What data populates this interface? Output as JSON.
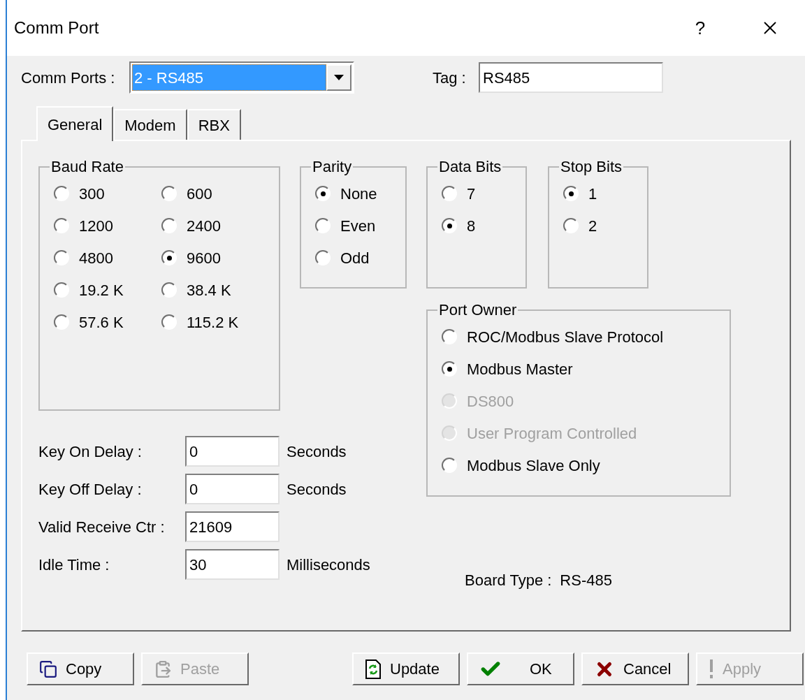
{
  "window": {
    "title": "Comm Port",
    "help": "?"
  },
  "comm_ports": {
    "label": "Comm Ports :",
    "value": "2 - RS485"
  },
  "tag": {
    "label": "Tag :",
    "value": "RS485"
  },
  "tabs": [
    {
      "label": "General",
      "selected": true
    },
    {
      "label": "Modem",
      "selected": false
    },
    {
      "label": "RBX",
      "selected": false
    }
  ],
  "baud_rate": {
    "title": "Baud Rate",
    "options": [
      {
        "label": "300",
        "selected": false
      },
      {
        "label": "600",
        "selected": false
      },
      {
        "label": "1200",
        "selected": false
      },
      {
        "label": "2400",
        "selected": false
      },
      {
        "label": "4800",
        "selected": false
      },
      {
        "label": "9600",
        "selected": true
      },
      {
        "label": "19.2 K",
        "selected": false
      },
      {
        "label": "38.4 K",
        "selected": false
      },
      {
        "label": "57.6 K",
        "selected": false
      },
      {
        "label": "115.2 K",
        "selected": false
      }
    ]
  },
  "parity": {
    "title": "Parity",
    "options": [
      {
        "label": "None",
        "selected": true
      },
      {
        "label": "Even",
        "selected": false
      },
      {
        "label": "Odd",
        "selected": false
      }
    ]
  },
  "data_bits": {
    "title": "Data Bits",
    "options": [
      {
        "label": "7",
        "selected": false
      },
      {
        "label": "8",
        "selected": true
      }
    ]
  },
  "stop_bits": {
    "title": "Stop Bits",
    "options": [
      {
        "label": "1",
        "selected": true
      },
      {
        "label": "2",
        "selected": false
      }
    ]
  },
  "port_owner": {
    "title": "Port Owner",
    "options": [
      {
        "label": "ROC/Modbus Slave Protocol",
        "selected": false,
        "disabled": false
      },
      {
        "label": "Modbus Master",
        "selected": true,
        "disabled": false
      },
      {
        "label": "DS800",
        "selected": false,
        "disabled": true
      },
      {
        "label": "User Program Controlled",
        "selected": false,
        "disabled": true
      },
      {
        "label": "Modbus Slave Only",
        "selected": false,
        "disabled": false
      }
    ]
  },
  "fields": [
    {
      "label": "Key On Delay :",
      "value": "0",
      "unit": "Seconds"
    },
    {
      "label": "Key Off Delay :",
      "value": "0",
      "unit": "Seconds"
    },
    {
      "label": "Valid Receive Ctr :",
      "value": "21609"
    },
    {
      "label": "Idle Time :",
      "value": "30",
      "unit": "Milliseconds"
    }
  ],
  "board_type": {
    "label": "Board Type :",
    "value": "RS-485"
  },
  "buttons": [
    {
      "kind": "copy",
      "label": "Copy",
      "disabled": false
    },
    {
      "kind": "paste",
      "label": "Paste",
      "disabled": true
    },
    {
      "kind": "update",
      "label": "Update",
      "disabled": false
    },
    {
      "kind": "ok",
      "label": "OK",
      "disabled": false
    },
    {
      "kind": "cancel",
      "label": "Cancel",
      "disabled": false
    },
    {
      "kind": "apply",
      "label": "Apply",
      "disabled": true
    }
  ]
}
